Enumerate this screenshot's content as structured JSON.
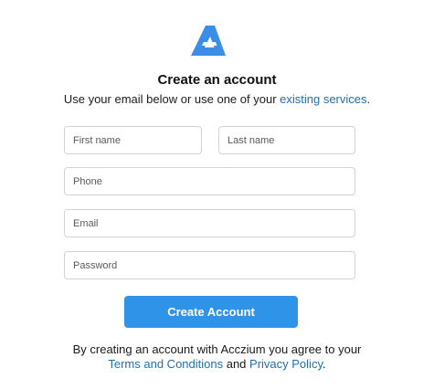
{
  "brand": {
    "logo_icon": "acczium-a-logo-icon",
    "logo_color": "#3a8ee6"
  },
  "header": {
    "title": "Create an account",
    "subtitle_prefix": "Use your email below or use one of your ",
    "subtitle_link": "existing services",
    "subtitle_suffix": "."
  },
  "form": {
    "first_name": {
      "placeholder": "First name",
      "value": ""
    },
    "last_name": {
      "placeholder": "Last name",
      "value": ""
    },
    "phone": {
      "placeholder": "Phone",
      "value": ""
    },
    "email": {
      "placeholder": "Email",
      "value": ""
    },
    "password": {
      "placeholder": "Password",
      "value": ""
    },
    "submit_label": "Create Account"
  },
  "legal": {
    "line1": "By creating an account with Acczium you agree to your",
    "terms_link": "Terms and Conditions",
    "joiner": " and ",
    "privacy_link": "Privacy Policy",
    "suffix": "."
  },
  "colors": {
    "accent": "#2f93e8",
    "link": "#1f6fb2",
    "border": "#cfd3d7"
  }
}
